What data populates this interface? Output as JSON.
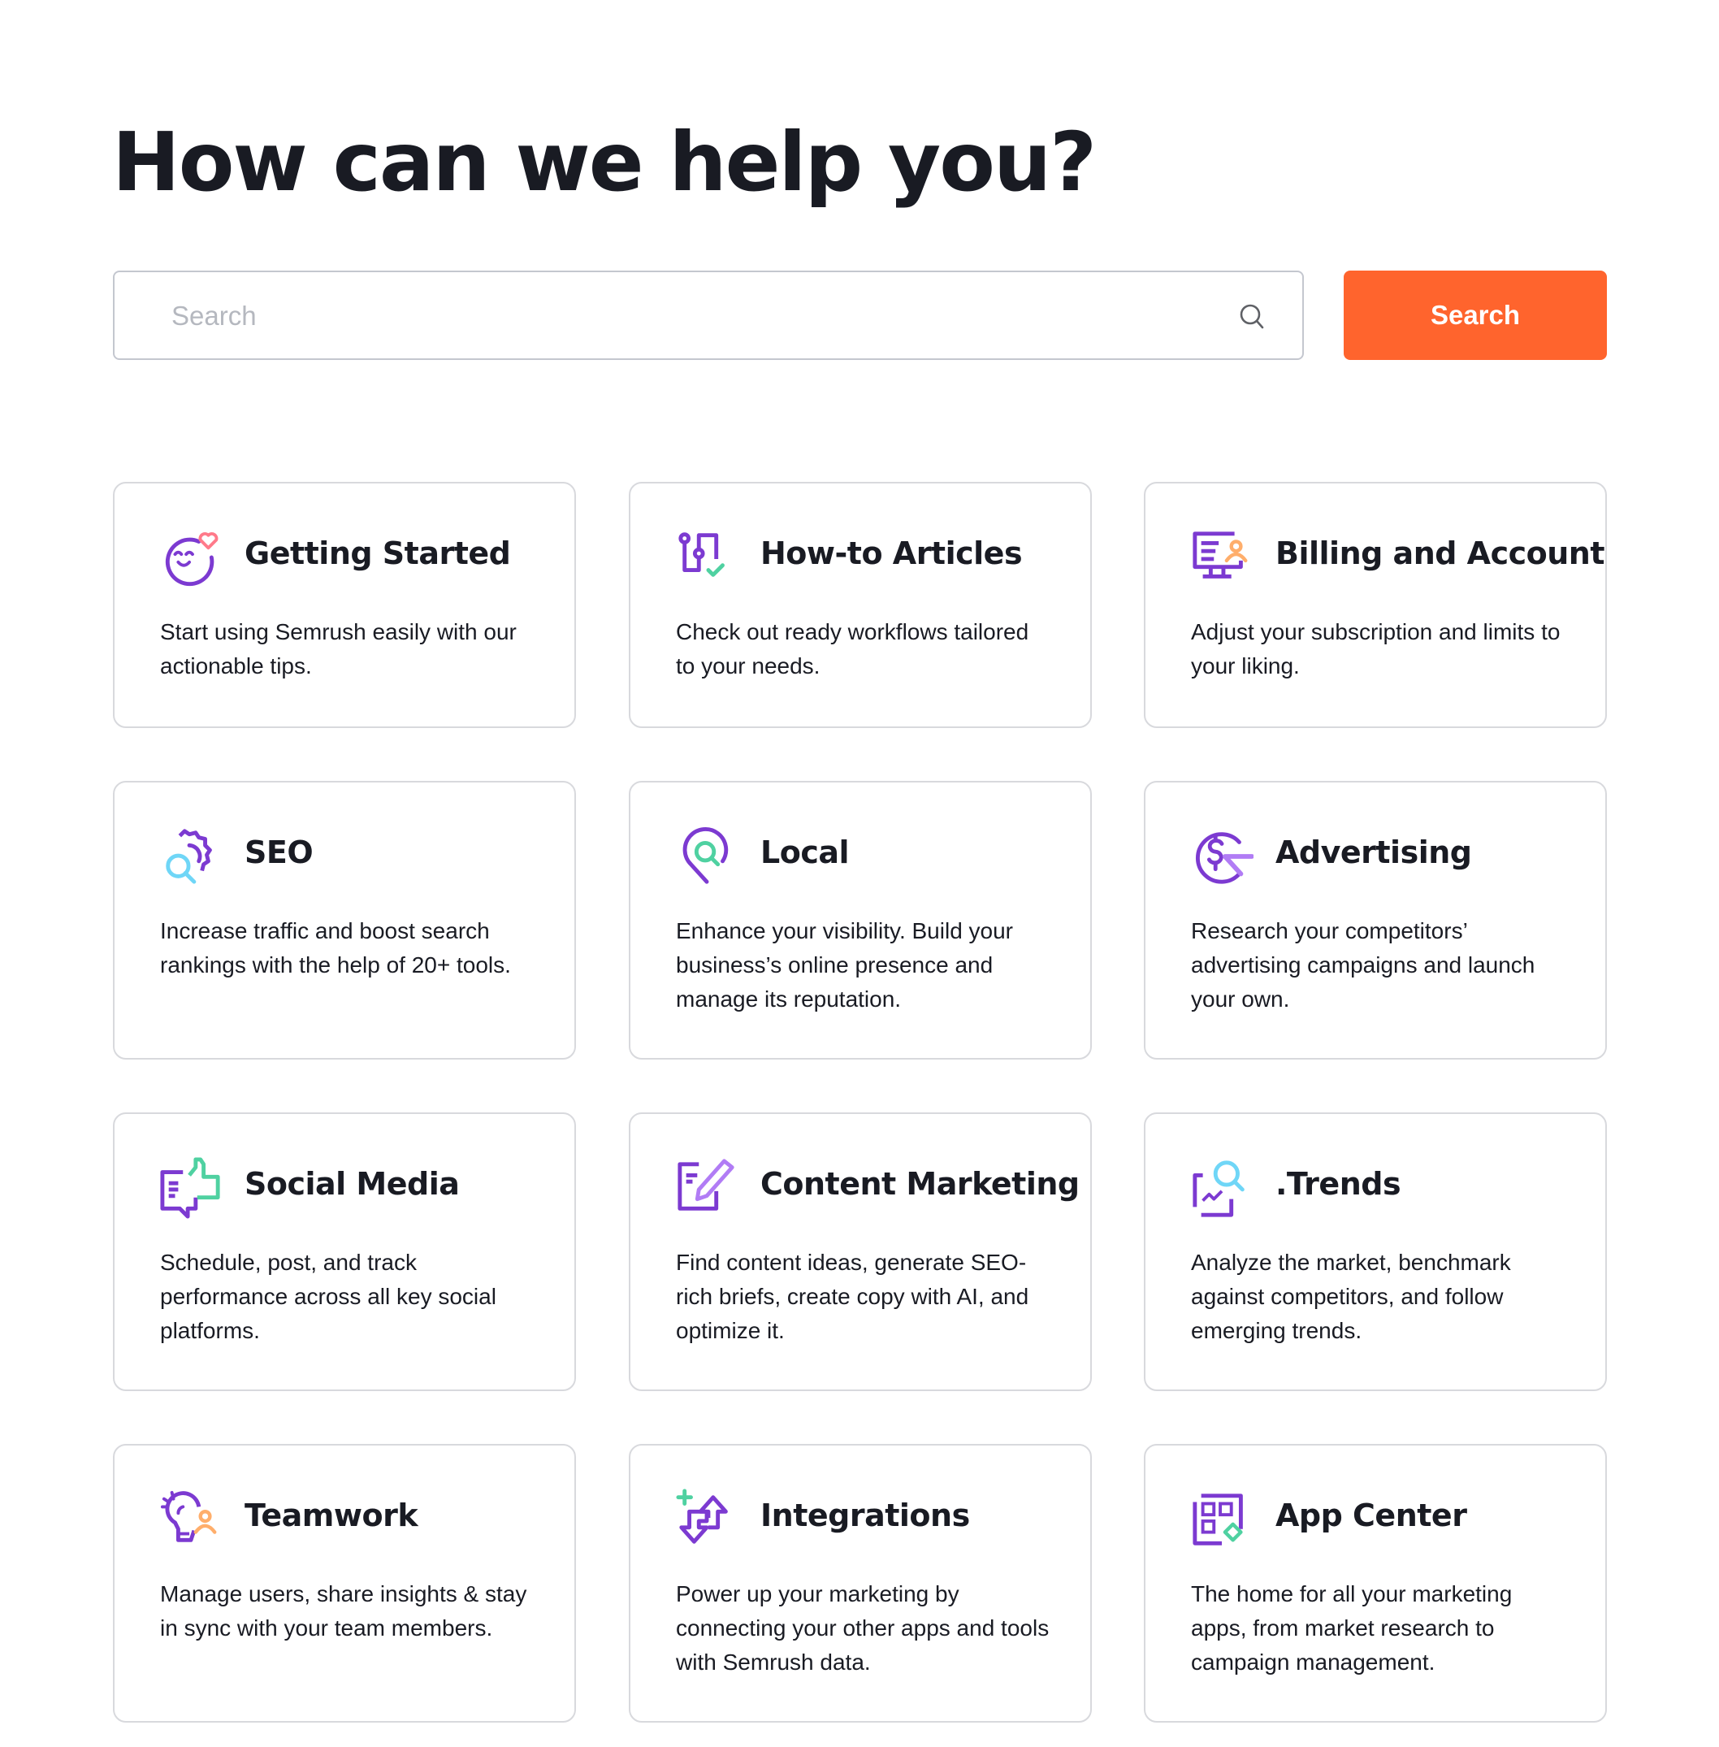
{
  "page": {
    "heading": "How can we help you?"
  },
  "search": {
    "placeholder": "Search",
    "value": "",
    "button_label": "Search",
    "icon": "search-icon"
  },
  "colors": {
    "accent": "#ff642d",
    "purple": "#7c3ad1",
    "light_purple": "#b17cf5",
    "green": "#4fd1a1",
    "blue": "#6fd6f7",
    "pink": "#ff7a8a",
    "orange": "#ffae6b"
  },
  "categories": [
    {
      "title": "Getting Started",
      "description": "Start using Semrush easily with our actionable tips.",
      "icon": "smiley-heart-icon"
    },
    {
      "title": "How-to Articles",
      "description": "Check out ready workflows tailored to your needs.",
      "icon": "workflow-path-check-icon"
    },
    {
      "title": "Billing and Account",
      "description": "Adjust your subscription and limits to your liking.",
      "icon": "monitor-user-icon"
    },
    {
      "title": "SEO",
      "description": "Increase traffic and boost search rankings with the help of 20+ tools.",
      "icon": "gear-magnifier-icon"
    },
    {
      "title": "Local",
      "description": "Enhance your visibility. Build your business’s online presence and manage its reputation.",
      "icon": "map-pin-search-icon"
    },
    {
      "title": "Advertising",
      "description": "Research your competitors’ advertising campaigns and launch your own.",
      "icon": "dollar-cursor-icon"
    },
    {
      "title": "Social Media",
      "description": "Schedule, post, and track performance across all key social platforms.",
      "icon": "chat-thumbs-up-icon"
    },
    {
      "title": "Content Marketing",
      "description": "Find content ideas, generate SEO-rich briefs, create copy with AI, and optimize it.",
      "icon": "document-pencil-icon"
    },
    {
      "title": ".Trends",
      "description": "Analyze the market, benchmark against competitors, and follow emerging trends.",
      "icon": "chart-magnifier-icon"
    },
    {
      "title": "Teamwork",
      "description": "Manage users, share insights & stay in sync with your team members.",
      "icon": "lightbulb-user-icon"
    },
    {
      "title": "Integrations",
      "description": "Power up your marketing by connecting your other apps and tools with Semrush data.",
      "icon": "arrows-exchange-plus-icon"
    },
    {
      "title": "App Center",
      "description": "The home for all your marketing apps, from market research to campaign management.",
      "icon": "app-grid-diamond-icon"
    }
  ]
}
